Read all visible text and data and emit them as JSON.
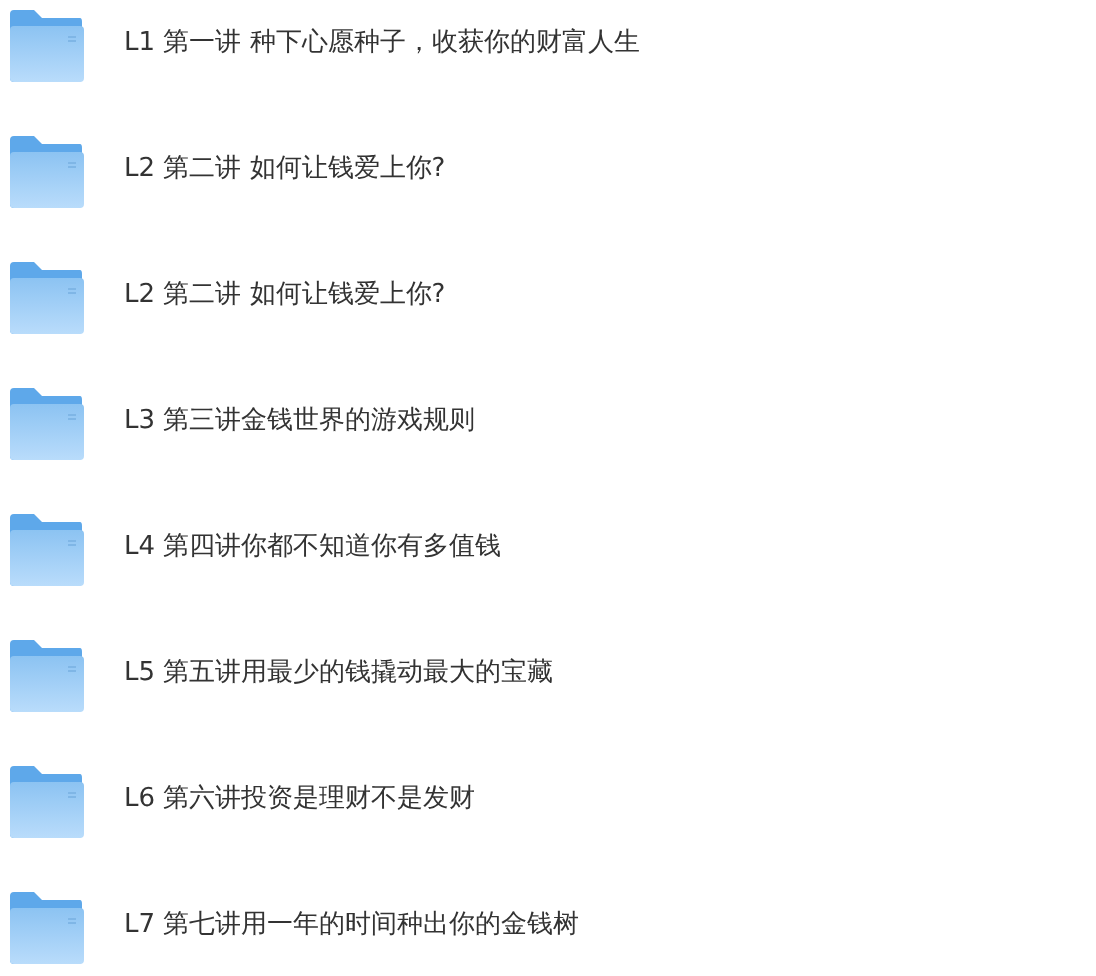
{
  "folders": [
    {
      "name": "L1 第一讲 种下心愿种子，收获你的财富人生"
    },
    {
      "name": "L2 第二讲 如何让钱爱上你?"
    },
    {
      "name": "L2 第二讲 如何让钱爱上你?"
    },
    {
      "name": "L3 第三讲金钱世界的游戏规则"
    },
    {
      "name": "L4 第四讲你都不知道你有多值钱"
    },
    {
      "name": "L5 第五讲用最少的钱撬动最大的宝藏"
    },
    {
      "name": "L6 第六讲投资是理财不是发财"
    },
    {
      "name": "L7 第七讲用一年的时间种出你的金钱树"
    }
  ]
}
